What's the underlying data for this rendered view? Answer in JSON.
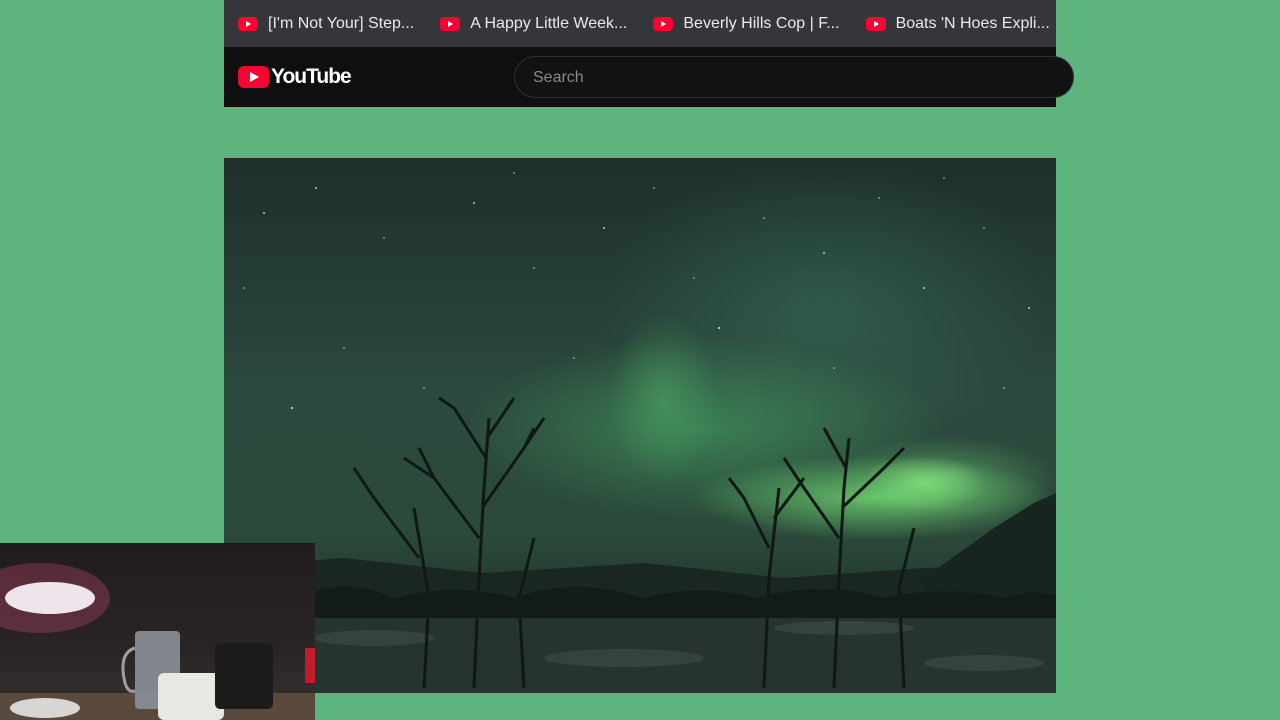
{
  "bookmarks_bar": {
    "items": [
      {
        "label": "[I'm Not Your] Step...",
        "icon": "youtube-icon"
      },
      {
        "label": "A Happy Little Week...",
        "icon": "youtube-icon"
      },
      {
        "label": "Beverly Hills Cop | F...",
        "icon": "youtube-icon"
      },
      {
        "label": "Boats 'N Hoes Expli...",
        "icon": "youtube-icon"
      }
    ]
  },
  "youtube": {
    "logo_text": "YouTube",
    "search": {
      "placeholder": "Search",
      "value": ""
    }
  },
  "colors": {
    "background": "#5db47f",
    "bookmarks_bar": "#35363a",
    "header": "#0f0f0f",
    "brand_red": "#ff0033"
  }
}
